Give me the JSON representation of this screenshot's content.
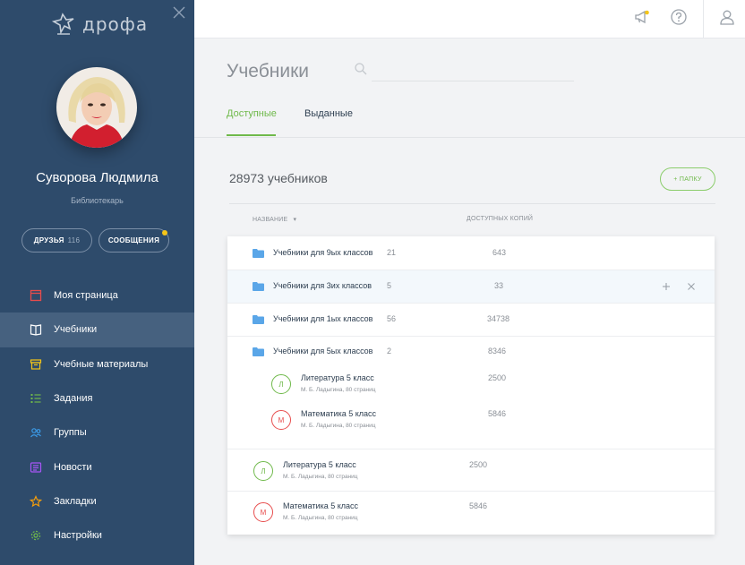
{
  "logo": {
    "text": "дрофа"
  },
  "user": {
    "name": "Суворова Людмила",
    "role": "Библиотекарь"
  },
  "pills": {
    "friends_label": "ДРУЗЬЯ",
    "friends_count": "116",
    "messages_label": "СООБЩЕНИЯ"
  },
  "nav": {
    "items": [
      {
        "label": "Моя страница",
        "icon": "page-icon",
        "color": "#e74c4c"
      },
      {
        "label": "Учебники",
        "icon": "book-icon",
        "color": "#ffffff"
      },
      {
        "label": "Учебные материалы",
        "icon": "archive-icon",
        "color": "#f5c518"
      },
      {
        "label": "Задания",
        "icon": "list-icon",
        "color": "#6fb94a"
      },
      {
        "label": "Группы",
        "icon": "group-icon",
        "color": "#3b9be8"
      },
      {
        "label": "Новости",
        "icon": "news-icon",
        "color": "#a855f7"
      },
      {
        "label": "Закладки",
        "icon": "star-icon",
        "color": "#f59e0b"
      },
      {
        "label": "Настройки",
        "icon": "gear-icon",
        "color": "#6fb94a"
      }
    ]
  },
  "header": {
    "title": "Учебники",
    "search_placeholder": "",
    "tabs": [
      "Доступные",
      "Выданные"
    ]
  },
  "content": {
    "count_title": "28973 учебников",
    "folder_button": "+ ПАПКУ",
    "col_name": "НАЗВАНИЕ",
    "col_copies": "ДОСТУПНЫХ КОПИЙ"
  },
  "rows": [
    {
      "name": "Учебники для 9ых классов",
      "count": "21",
      "copies": "643"
    },
    {
      "name": "Учебники для 3их классов",
      "count": "5",
      "copies": "33"
    },
    {
      "name": "Учебники для 1ых классов",
      "count": "56",
      "copies": "34738"
    },
    {
      "name": "Учебники для 5ых классов",
      "count": "2",
      "copies": "8346"
    }
  ],
  "nested_books": [
    {
      "letter": "Л",
      "title": "Литература 5 класс",
      "sub": "М. Б. Ладыгина, 80 страниц",
      "copies": "2500"
    },
    {
      "letter": "М",
      "title": "Математика 5 класс",
      "sub": "М. Б. Ладыгина, 80 страниц",
      "copies": "5846"
    }
  ],
  "books": [
    {
      "letter": "Л",
      "title": "Литература 5 класс",
      "sub": "М. Б. Ладыгина, 80 страниц",
      "copies": "2500"
    },
    {
      "letter": "М",
      "title": "Математика 5 класс",
      "sub": "М. Б. Ладыгина, 80 страниц",
      "copies": "5846"
    }
  ],
  "colors": {
    "sidebar": "#2e4b6b",
    "accent_green": "#6fb94a",
    "accent_red": "#e74c4c",
    "folder_blue": "#5aa6e8"
  }
}
